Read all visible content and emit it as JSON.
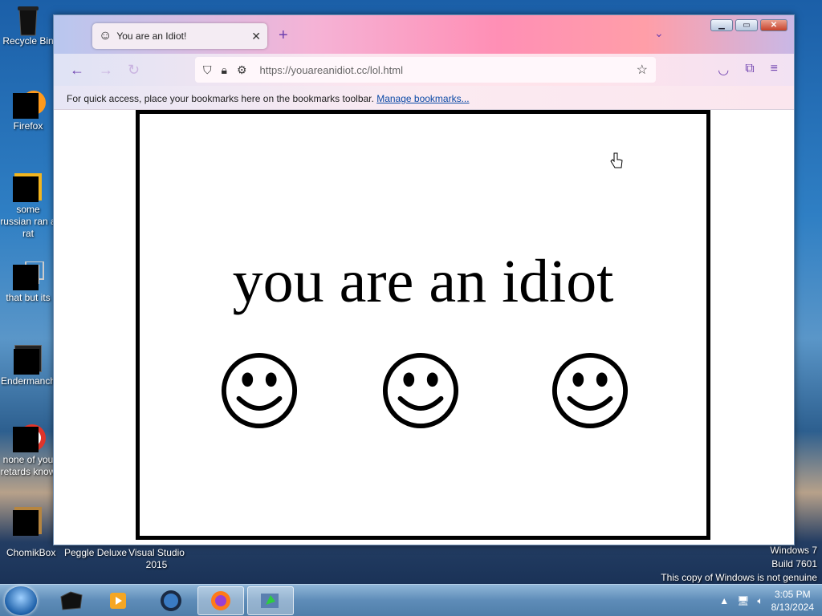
{
  "desktop": {
    "icons": [
      {
        "label": "Recycle Bin"
      },
      {
        "label": "Firefox"
      },
      {
        "label": "some russian ran a rat"
      },
      {
        "label": "that but its"
      },
      {
        "label": "Endermanch"
      },
      {
        "label": "none of you retards know"
      }
    ],
    "bottom_row": [
      {
        "label": "ChomikBox"
      },
      {
        "label": "Peggle Deluxe"
      },
      {
        "label": "Visual Studio 2015"
      }
    ],
    "watermark": {
      "line1": "Windows 7",
      "line2": "Build 7601",
      "line3": "This copy of Windows is not genuine"
    }
  },
  "browser": {
    "tab_title": "You are an Idiot!",
    "url": "https://youareanidiot.cc/lol.html",
    "bookmarks_text": "For quick access, place your bookmarks here on the bookmarks toolbar.",
    "bookmarks_link": "Manage bookmarks..."
  },
  "page": {
    "headline": "you are an idiot"
  },
  "taskbar": {
    "time": "3:05 PM",
    "date": "8/13/2024"
  }
}
